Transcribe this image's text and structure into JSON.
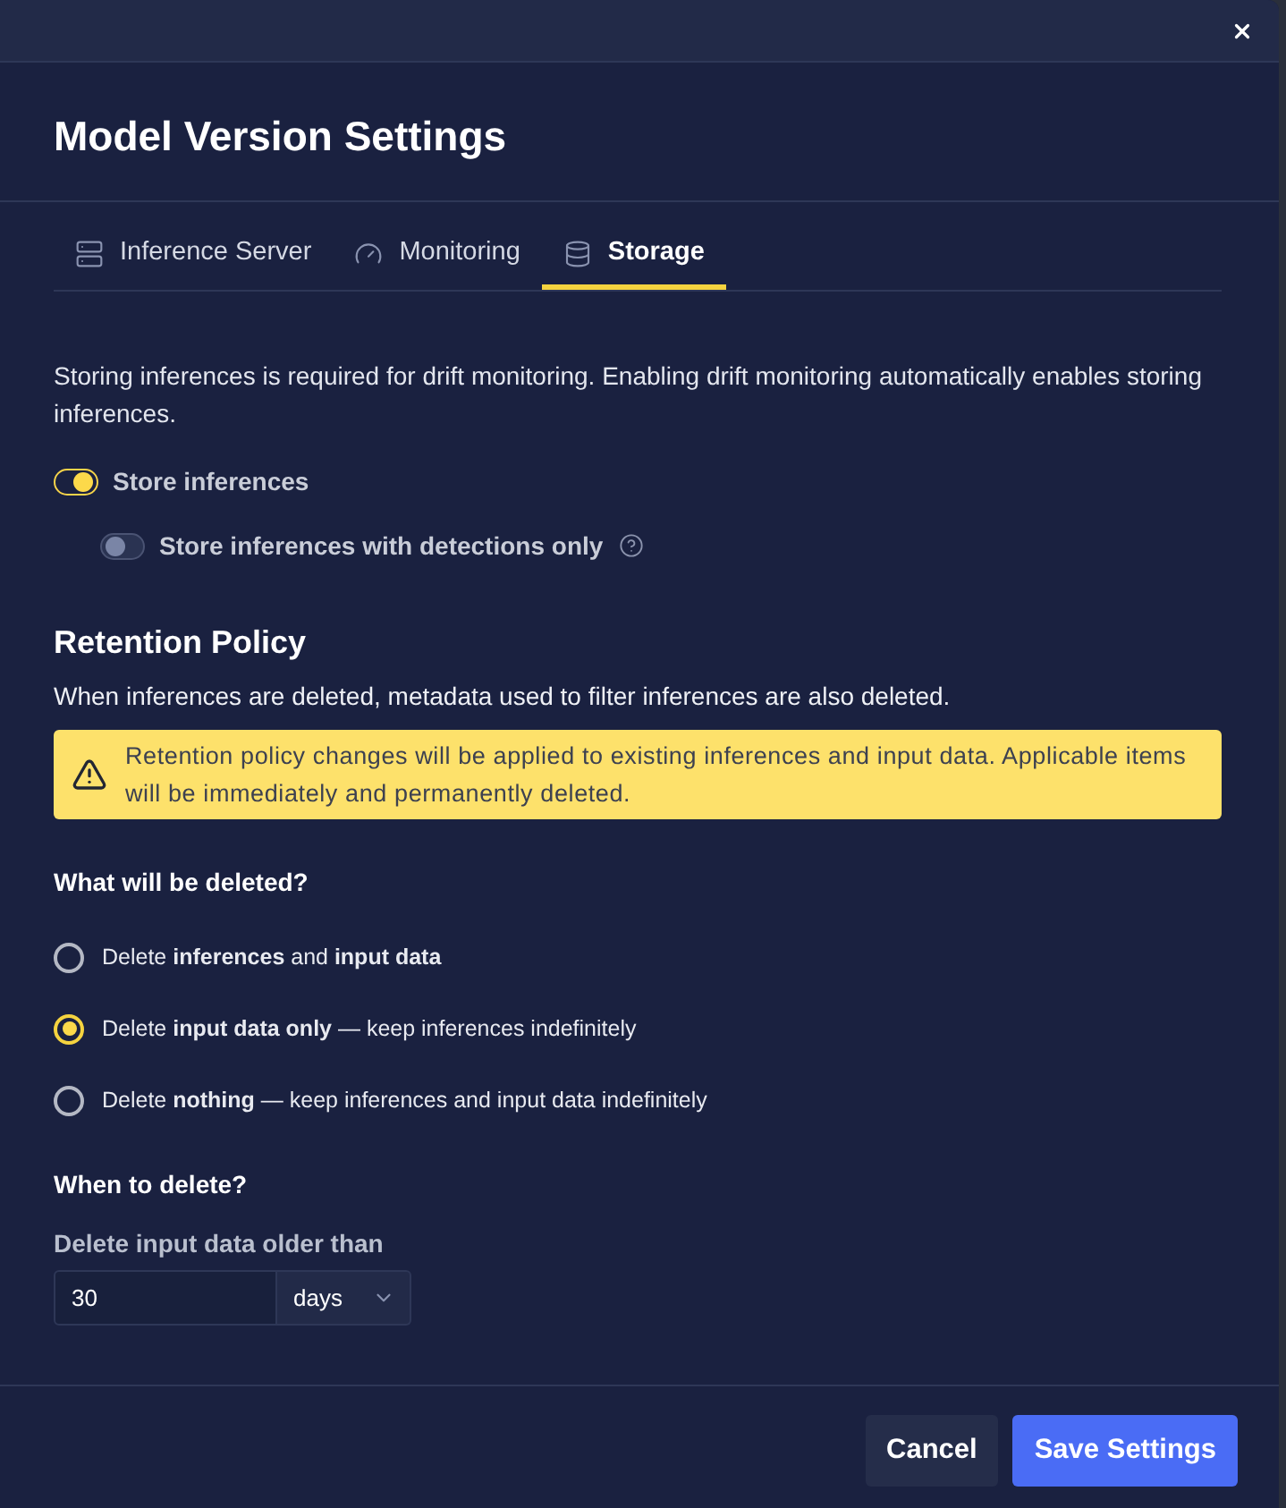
{
  "dialog": {
    "title": "Model Version Settings"
  },
  "tabs": [
    {
      "label": "Inference Server",
      "kind": "server",
      "selected": false
    },
    {
      "label": "Monitoring",
      "kind": "gauge",
      "selected": false
    },
    {
      "label": "Storage",
      "kind": "database",
      "selected": true
    }
  ],
  "storage": {
    "intro": "Storing inferences is required for drift monitoring. Enabling drift monitoring automatically enables storing inferences.",
    "toggles": [
      {
        "label": "Store inferences",
        "on": true,
        "children": [
          {
            "label": "Store inferences with detections only",
            "on": false,
            "help": true
          }
        ]
      }
    ]
  },
  "retention_policy": {
    "heading": "Retention Policy",
    "description": "When inferences are deleted, metadata used to filter inferences are also deleted.",
    "warning": "Retention policy changes will be applied to existing inferences and input data. Applicable items will be immediately and permanently deleted.",
    "question": "What will be deleted?",
    "options": [
      {
        "label": "Delete **inferences** and **input data**",
        "selected": false
      },
      {
        "label": "Delete **input data only** — keep inferences indefinitely",
        "selected": true
      },
      {
        "label": "Delete **nothing** — keep inferences and input data indefinitely",
        "selected": false
      }
    ],
    "when_heading": "When to delete?",
    "age_field": {
      "label": "Delete input data older than",
      "value": "30",
      "unit": "days"
    }
  },
  "buttons": [
    {
      "label": "Cancel",
      "kind": "secondary"
    },
    {
      "label": "Save Settings",
      "kind": "primary"
    }
  ]
}
